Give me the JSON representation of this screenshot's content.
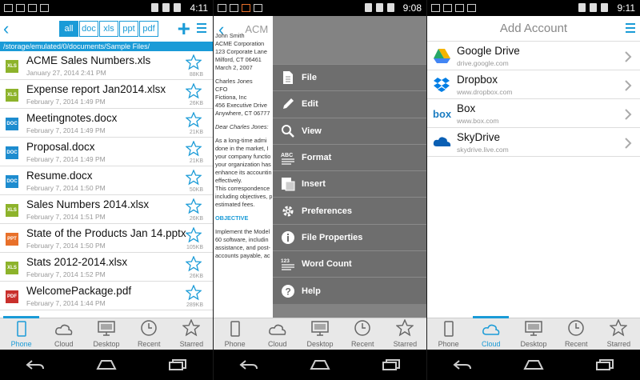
{
  "panel1": {
    "status": {
      "time": "4:11"
    },
    "filters": [
      "all",
      "doc",
      "xls",
      "ppt",
      "pdf"
    ],
    "path": "/storage/emulated/0/documents/Sample Files/",
    "files": [
      {
        "name": "ACME Sales Numbers.xls",
        "date": "January 27, 2014 2:41 PM",
        "size": "88KB",
        "type": "XLS",
        "color": "#8db32b"
      },
      {
        "name": "Expense report Jan2014.xlsx",
        "date": "February 7, 2014 1:49 PM",
        "size": "26KB",
        "type": "XLS",
        "color": "#8db32b"
      },
      {
        "name": "Meetingnotes.docx",
        "date": "February 7, 2014 1:49 PM",
        "size": "21KB",
        "type": "DOC",
        "color": "#1d8ccf"
      },
      {
        "name": "Proposal.docx",
        "date": "February 7, 2014 1:49 PM",
        "size": "21KB",
        "type": "DOC",
        "color": "#1d8ccf"
      },
      {
        "name": "Resume.docx",
        "date": "February 7, 2014 1:50 PM",
        "size": "50KB",
        "type": "DOC",
        "color": "#1d8ccf"
      },
      {
        "name": "Sales Numbers 2014.xlsx",
        "date": "February 7, 2014 1:51 PM",
        "size": "26KB",
        "type": "XLS",
        "color": "#8db32b"
      },
      {
        "name": "State of the Products Jan 14.pptx",
        "date": "February 7, 2014 1:50 PM",
        "size": "105KB",
        "type": "PPT",
        "color": "#e8702a"
      },
      {
        "name": "Stats 2012-2014.xlsx",
        "date": "February 7, 2014 1:52 PM",
        "size": "26KB",
        "type": "XLS",
        "color": "#8db32b"
      },
      {
        "name": "WelcomePackage.pdf",
        "date": "February 7, 2014 1:44 PM",
        "size": "289KB",
        "type": "PDF",
        "color": "#c9302c"
      }
    ],
    "tabs": [
      {
        "label": "Phone",
        "icon": "phone-icon"
      },
      {
        "label": "Cloud",
        "icon": "cloud-icon"
      },
      {
        "label": "Desktop",
        "icon": "desktop-icon"
      },
      {
        "label": "Recent",
        "icon": "clock-icon"
      },
      {
        "label": "Starred",
        "icon": "star-icon"
      }
    ]
  },
  "panel2": {
    "status": {
      "time": "9:08"
    },
    "doc_title": "ACM",
    "doc_lines": [
      "John Smith",
      "ACME Corporation",
      "123 Corporate Lane",
      "Milford, CT 06461",
      "March 2, 2007",
      "Charles Jones",
      "CFO",
      "Fictiona, Inc",
      "456 Executive Drive",
      "Anywhere, CT 06777",
      "Dear Charles Jones:",
      "As a long-time admi",
      "done in the market, I",
      "your company functio",
      "your organization has",
      "enhance its accountin",
      "effectively.",
      "This correspondence",
      "including objectives, p",
      "estimated fees.",
      "OBJECTIVE",
      "Implement the Model",
      "60 software, includin",
      "assistance, and post-",
      "accounts payable, ac"
    ],
    "menu": [
      {
        "label": "File",
        "icon": "file-icon"
      },
      {
        "label": "Edit",
        "icon": "pencil-icon"
      },
      {
        "label": "View",
        "icon": "magnifier-icon"
      },
      {
        "label": "Format",
        "icon": "format-icon"
      },
      {
        "label": "Insert",
        "icon": "insert-icon"
      },
      {
        "label": "Preferences",
        "icon": "gear-icon"
      },
      {
        "label": "File Properties",
        "icon": "info-icon"
      },
      {
        "label": "Word Count",
        "icon": "word-count-icon"
      },
      {
        "label": "Help",
        "icon": "help-icon"
      }
    ]
  },
  "panel3": {
    "status": {
      "time": "9:11"
    },
    "title": "Add Account",
    "accounts": [
      {
        "name": "Google Drive",
        "url": "drive.google.com",
        "icon": "google-drive-icon"
      },
      {
        "name": "Dropbox",
        "url": "www.dropbox.com",
        "icon": "dropbox-icon"
      },
      {
        "name": "Box",
        "url": "www.box.com",
        "icon": "box-icon"
      },
      {
        "name": "SkyDrive",
        "url": "skydrive.live.com",
        "icon": "skydrive-icon"
      }
    ]
  }
}
